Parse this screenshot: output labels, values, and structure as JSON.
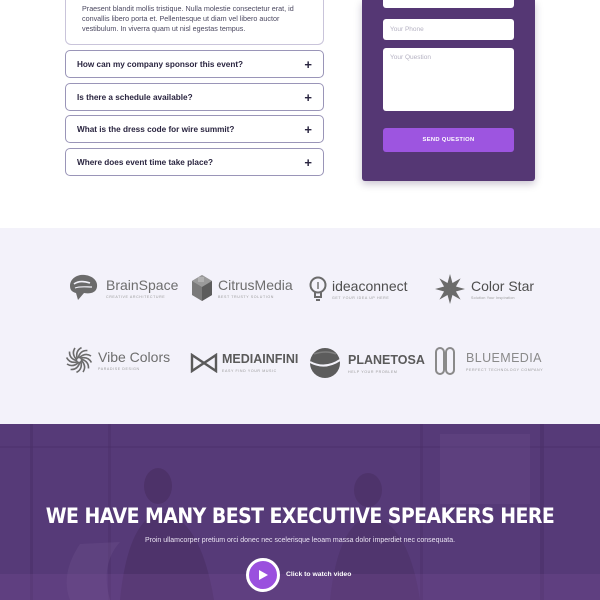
{
  "faq": {
    "open_answer": "Praesent blandit mollis tristique. Nulla molestie consectetur erat, id convallis libero porta et. Pellentesque ut diam vel libero auctor vestibulum. In viverra quam ut nisl egestas tempus.",
    "items": [
      {
        "question": "How can my company sponsor this event?",
        "icon": "plus-icon"
      },
      {
        "question": "Is there a schedule available?",
        "icon": "plus-icon"
      },
      {
        "question": "What is the dress code for wire summit?",
        "icon": "plus-icon"
      },
      {
        "question": "Where does event time take place?",
        "icon": "plus-icon"
      }
    ]
  },
  "form": {
    "phone_placeholder": "Your Phone",
    "question_placeholder": "Your Question",
    "submit_label": "SEND QUESTION",
    "panel_color": "#553774",
    "button_color": "#9d55e0"
  },
  "logos": [
    {
      "name": "BrainSpace",
      "tagline": "CREATIVE ARCHITECTURE",
      "icon": "brain-icon"
    },
    {
      "name": "CitrusMedia",
      "tagline": "BEST TRUSTY SOLUTION",
      "icon": "cube-icon"
    },
    {
      "name": "ideaconnect",
      "tagline": "GET YOUR IDEA UP HERE",
      "icon": "lightbulb-icon"
    },
    {
      "name": "Color Star",
      "tagline": "Solution Your Inspiration",
      "icon": "star-icon"
    },
    {
      "name": "Vibe Colors",
      "tagline": "PARADISE DESIGN",
      "icon": "spiral-icon"
    },
    {
      "name": "MEDIAINFINI",
      "tagline": "EASY FIND YOUR MUSIC",
      "icon": "bowtie-icon"
    },
    {
      "name": "PLANETOSA",
      "tagline": "HELP YOUR PROBLEM",
      "icon": "planet-icon"
    },
    {
      "name": "BLUEMEDIA",
      "tagline": "PERFECT TECHNOLOGY COMPANY",
      "icon": "paperclip-icon"
    }
  ],
  "hero": {
    "title": "WE HAVE MANY BEST EXECUTIVE SPEAKERS HERE",
    "subtitle": "Proin ullamcorper pretium orci donec nec scelerisque leoam massa dolor imperdiet nec consequata.",
    "cta_label": "Click to watch video",
    "play_icon": "play-icon",
    "overlay_color": "#563a78"
  }
}
